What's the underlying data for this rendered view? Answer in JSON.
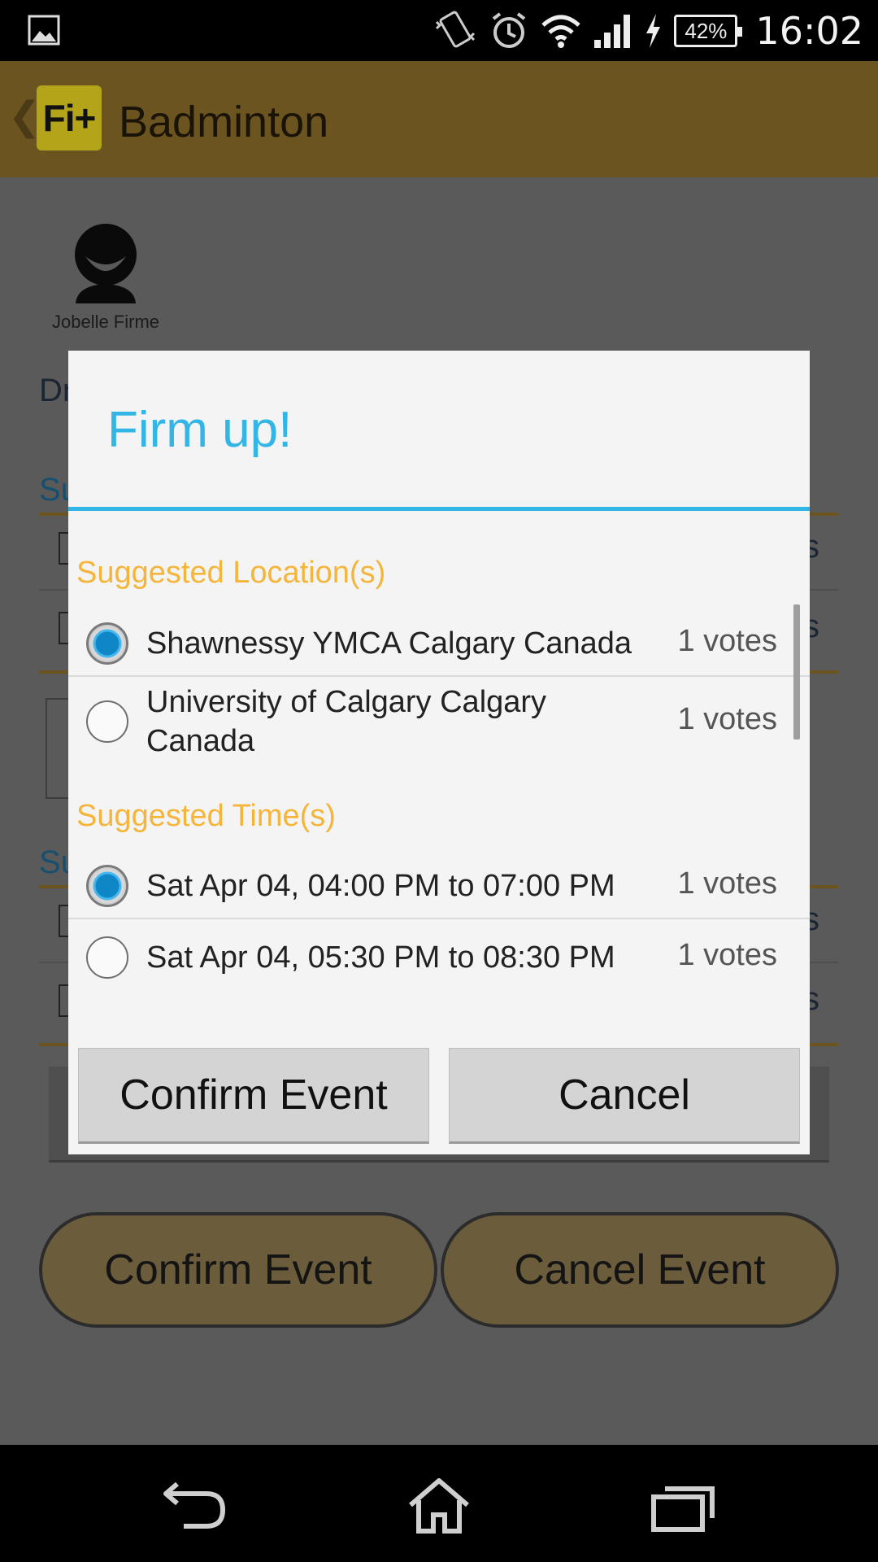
{
  "status_bar": {
    "icons": [
      "image-icon",
      "vibrate-icon",
      "alarm-icon",
      "wifi-icon",
      "signal-icon",
      "charging-icon"
    ],
    "battery": "42%",
    "time": "16:02"
  },
  "app_bar": {
    "logo_text": "Fi+",
    "title": "Badminton",
    "color": "#6b5420"
  },
  "background": {
    "attendee_name": "Jobelle Firme",
    "fragments": {
      "dr": "Dr",
      "su1": "Su",
      "su2": "Su",
      "s1": "s",
      "s2": "s",
      "s3": "s",
      "s4": "s"
    },
    "buttons": {
      "confirm": "Confirm Event",
      "cancel": "Cancel Event"
    }
  },
  "dialog": {
    "title": "Firm up!",
    "accent_color": "#33b5e5",
    "section_color": "#f5b53b",
    "locations_heading": "Suggested Location(s)",
    "locations": [
      {
        "label": "Shawnessy YMCA Calgary Canada",
        "votes": "1 votes",
        "selected": true
      },
      {
        "label": "University of Calgary Calgary Canada",
        "votes": "1 votes",
        "selected": false
      }
    ],
    "times_heading": "Suggested Time(s)",
    "times": [
      {
        "label": "Sat Apr 04, 04:00 PM to 07:00 PM",
        "votes": "1 votes",
        "selected": true
      },
      {
        "label": "Sat Apr 04, 05:30 PM to 08:30 PM",
        "votes": "1 votes",
        "selected": false
      }
    ],
    "confirm_label": "Confirm Event",
    "cancel_label": "Cancel"
  },
  "nav_bar": {
    "icons": [
      "back-icon",
      "home-icon",
      "recents-icon"
    ]
  }
}
